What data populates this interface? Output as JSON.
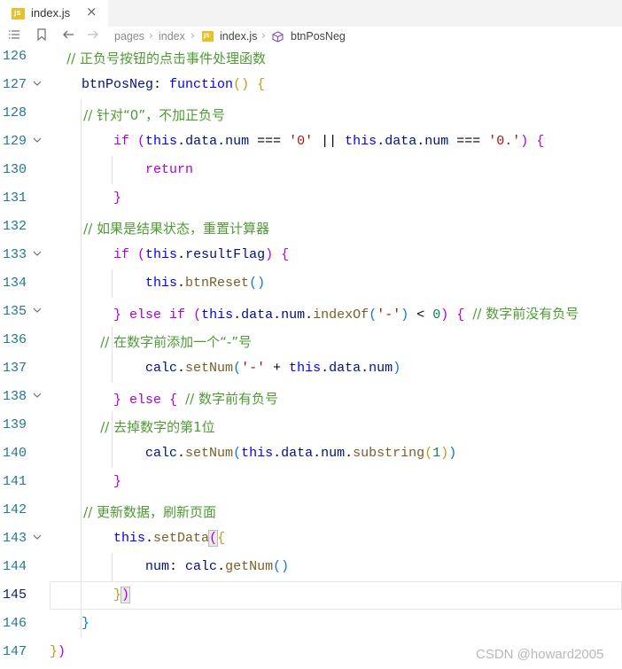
{
  "tab": {
    "file_icon_text": "JS",
    "label": "index.js",
    "close": "×"
  },
  "breadcrumb": {
    "items": [
      "pages",
      "index",
      "index.js",
      "btnPosNeg"
    ],
    "separator": "›"
  },
  "icons": {
    "list": "list-icon",
    "bookmark": "bookmark-icon",
    "back": "back-arrow-icon",
    "forward": "forward-arrow-icon",
    "cube": "method-cube-icon"
  },
  "colors": {
    "comment": "#4f9b35",
    "keyword": "#0000ff",
    "string": "#a31515",
    "number": "#098658",
    "line_number": "#237893"
  },
  "current_line": "145",
  "lines": [
    {
      "num": "126",
      "fold": false,
      "tokens": [
        [
          "c",
          "    // 正负号按钮的点击事件处理函数"
        ]
      ]
    },
    {
      "num": "127",
      "fold": true,
      "tokens": [
        [
          "v",
          "    btnPosNeg"
        ],
        [
          "p",
          ": "
        ],
        [
          "k",
          "function"
        ],
        [
          "b1",
          "()"
        ],
        [
          "p",
          " "
        ],
        [
          "b1",
          "{"
        ]
      ]
    },
    {
      "num": "128",
      "fold": false,
      "tokens": [
        [
          "c",
          "        // 针对“0”，不加正负号"
        ]
      ]
    },
    {
      "num": "129",
      "fold": true,
      "tokens": [
        [
          "kc",
          "        if"
        ],
        [
          "p",
          " "
        ],
        [
          "b2",
          "("
        ],
        [
          "k",
          "this"
        ],
        [
          "p",
          "."
        ],
        [
          "v",
          "data"
        ],
        [
          "p",
          "."
        ],
        [
          "v",
          "num"
        ],
        [
          "p",
          " === "
        ],
        [
          "s",
          "'0'"
        ],
        [
          "p",
          " || "
        ],
        [
          "k",
          "this"
        ],
        [
          "p",
          "."
        ],
        [
          "v",
          "data"
        ],
        [
          "p",
          "."
        ],
        [
          "v",
          "num"
        ],
        [
          "p",
          " === "
        ],
        [
          "s",
          "'0.'"
        ],
        [
          "b2",
          ")"
        ],
        [
          "p",
          " "
        ],
        [
          "b2",
          "{"
        ]
      ]
    },
    {
      "num": "130",
      "fold": false,
      "tokens": [
        [
          "kc",
          "            return"
        ]
      ]
    },
    {
      "num": "131",
      "fold": false,
      "tokens": [
        [
          "b2",
          "        }"
        ]
      ]
    },
    {
      "num": "132",
      "fold": false,
      "tokens": [
        [
          "c",
          "        // 如果是结果状态，重置计算器"
        ]
      ]
    },
    {
      "num": "133",
      "fold": true,
      "tokens": [
        [
          "kc",
          "        if"
        ],
        [
          "p",
          " "
        ],
        [
          "b2",
          "("
        ],
        [
          "k",
          "this"
        ],
        [
          "p",
          "."
        ],
        [
          "v",
          "resultFlag"
        ],
        [
          "b2",
          ")"
        ],
        [
          "p",
          " "
        ],
        [
          "b2",
          "{"
        ]
      ]
    },
    {
      "num": "134",
      "fold": false,
      "tokens": [
        [
          "k",
          "            this"
        ],
        [
          "p",
          "."
        ],
        [
          "f",
          "btnReset"
        ],
        [
          "b3",
          "()"
        ]
      ]
    },
    {
      "num": "135",
      "fold": true,
      "tokens": [
        [
          "b2",
          "        }"
        ],
        [
          "p",
          " "
        ],
        [
          "kc",
          "else if"
        ],
        [
          "p",
          " "
        ],
        [
          "b2",
          "("
        ],
        [
          "k",
          "this"
        ],
        [
          "p",
          "."
        ],
        [
          "v",
          "data"
        ],
        [
          "p",
          "."
        ],
        [
          "v",
          "num"
        ],
        [
          "p",
          "."
        ],
        [
          "f",
          "indexOf"
        ],
        [
          "b3",
          "("
        ],
        [
          "s",
          "'-'"
        ],
        [
          "b3",
          ")"
        ],
        [
          "p",
          " < "
        ],
        [
          "n",
          "0"
        ],
        [
          "b2",
          ")"
        ],
        [
          "p",
          " "
        ],
        [
          "b2",
          "{"
        ],
        [
          "p",
          " "
        ],
        [
          "c",
          "// 数字前没有负号"
        ]
      ]
    },
    {
      "num": "136",
      "fold": false,
      "tokens": [
        [
          "c",
          "            // 在数字前添加一个“-”号"
        ]
      ]
    },
    {
      "num": "137",
      "fold": false,
      "tokens": [
        [
          "v",
          "            calc"
        ],
        [
          "p",
          "."
        ],
        [
          "f",
          "setNum"
        ],
        [
          "b3",
          "("
        ],
        [
          "s",
          "'-'"
        ],
        [
          "p",
          " + "
        ],
        [
          "k",
          "this"
        ],
        [
          "p",
          "."
        ],
        [
          "v",
          "data"
        ],
        [
          "p",
          "."
        ],
        [
          "v",
          "num"
        ],
        [
          "b3",
          ")"
        ]
      ]
    },
    {
      "num": "138",
      "fold": true,
      "tokens": [
        [
          "b2",
          "        }"
        ],
        [
          "p",
          " "
        ],
        [
          "kc",
          "else"
        ],
        [
          "p",
          " "
        ],
        [
          "b2",
          "{"
        ],
        [
          "p",
          " "
        ],
        [
          "c",
          "// 数字前有负号"
        ]
      ]
    },
    {
      "num": "139",
      "fold": false,
      "tokens": [
        [
          "c",
          "            // 去掉数字的第1位"
        ]
      ]
    },
    {
      "num": "140",
      "fold": false,
      "tokens": [
        [
          "v",
          "            calc"
        ],
        [
          "p",
          "."
        ],
        [
          "f",
          "setNum"
        ],
        [
          "b3",
          "("
        ],
        [
          "k",
          "this"
        ],
        [
          "p",
          "."
        ],
        [
          "v",
          "data"
        ],
        [
          "p",
          "."
        ],
        [
          "v",
          "num"
        ],
        [
          "p",
          "."
        ],
        [
          "f",
          "substring"
        ],
        [
          "b1",
          "("
        ],
        [
          "n",
          "1"
        ],
        [
          "b1",
          ")"
        ],
        [
          "b3",
          ")"
        ]
      ]
    },
    {
      "num": "141",
      "fold": false,
      "tokens": [
        [
          "b2",
          "        }"
        ]
      ]
    },
    {
      "num": "142",
      "fold": false,
      "tokens": [
        [
          "c",
          "        // 更新数据，刷新页面"
        ]
      ]
    },
    {
      "num": "143",
      "fold": true,
      "tokens": [
        [
          "k",
          "        this"
        ],
        [
          "p",
          "."
        ],
        [
          "f",
          "setData"
        ],
        [
          "b2m",
          "("
        ],
        [
          "b1",
          "{"
        ]
      ]
    },
    {
      "num": "144",
      "fold": false,
      "tokens": [
        [
          "v",
          "            num"
        ],
        [
          "p",
          ": "
        ],
        [
          "v",
          "calc"
        ],
        [
          "p",
          "."
        ],
        [
          "f",
          "getNum"
        ],
        [
          "b3",
          "()"
        ]
      ]
    },
    {
      "num": "145",
      "fold": false,
      "tokens": [
        [
          "b1",
          "        }"
        ],
        [
          "b2m",
          ")"
        ]
      ]
    },
    {
      "num": "146",
      "fold": false,
      "tokens": [
        [
          "b3",
          "    }"
        ]
      ]
    },
    {
      "num": "147",
      "fold": false,
      "tokens": [
        [
          "b1",
          "}"
        ],
        [
          "b2",
          ")"
        ]
      ]
    }
  ],
  "watermark": "CSDN @howard2005"
}
